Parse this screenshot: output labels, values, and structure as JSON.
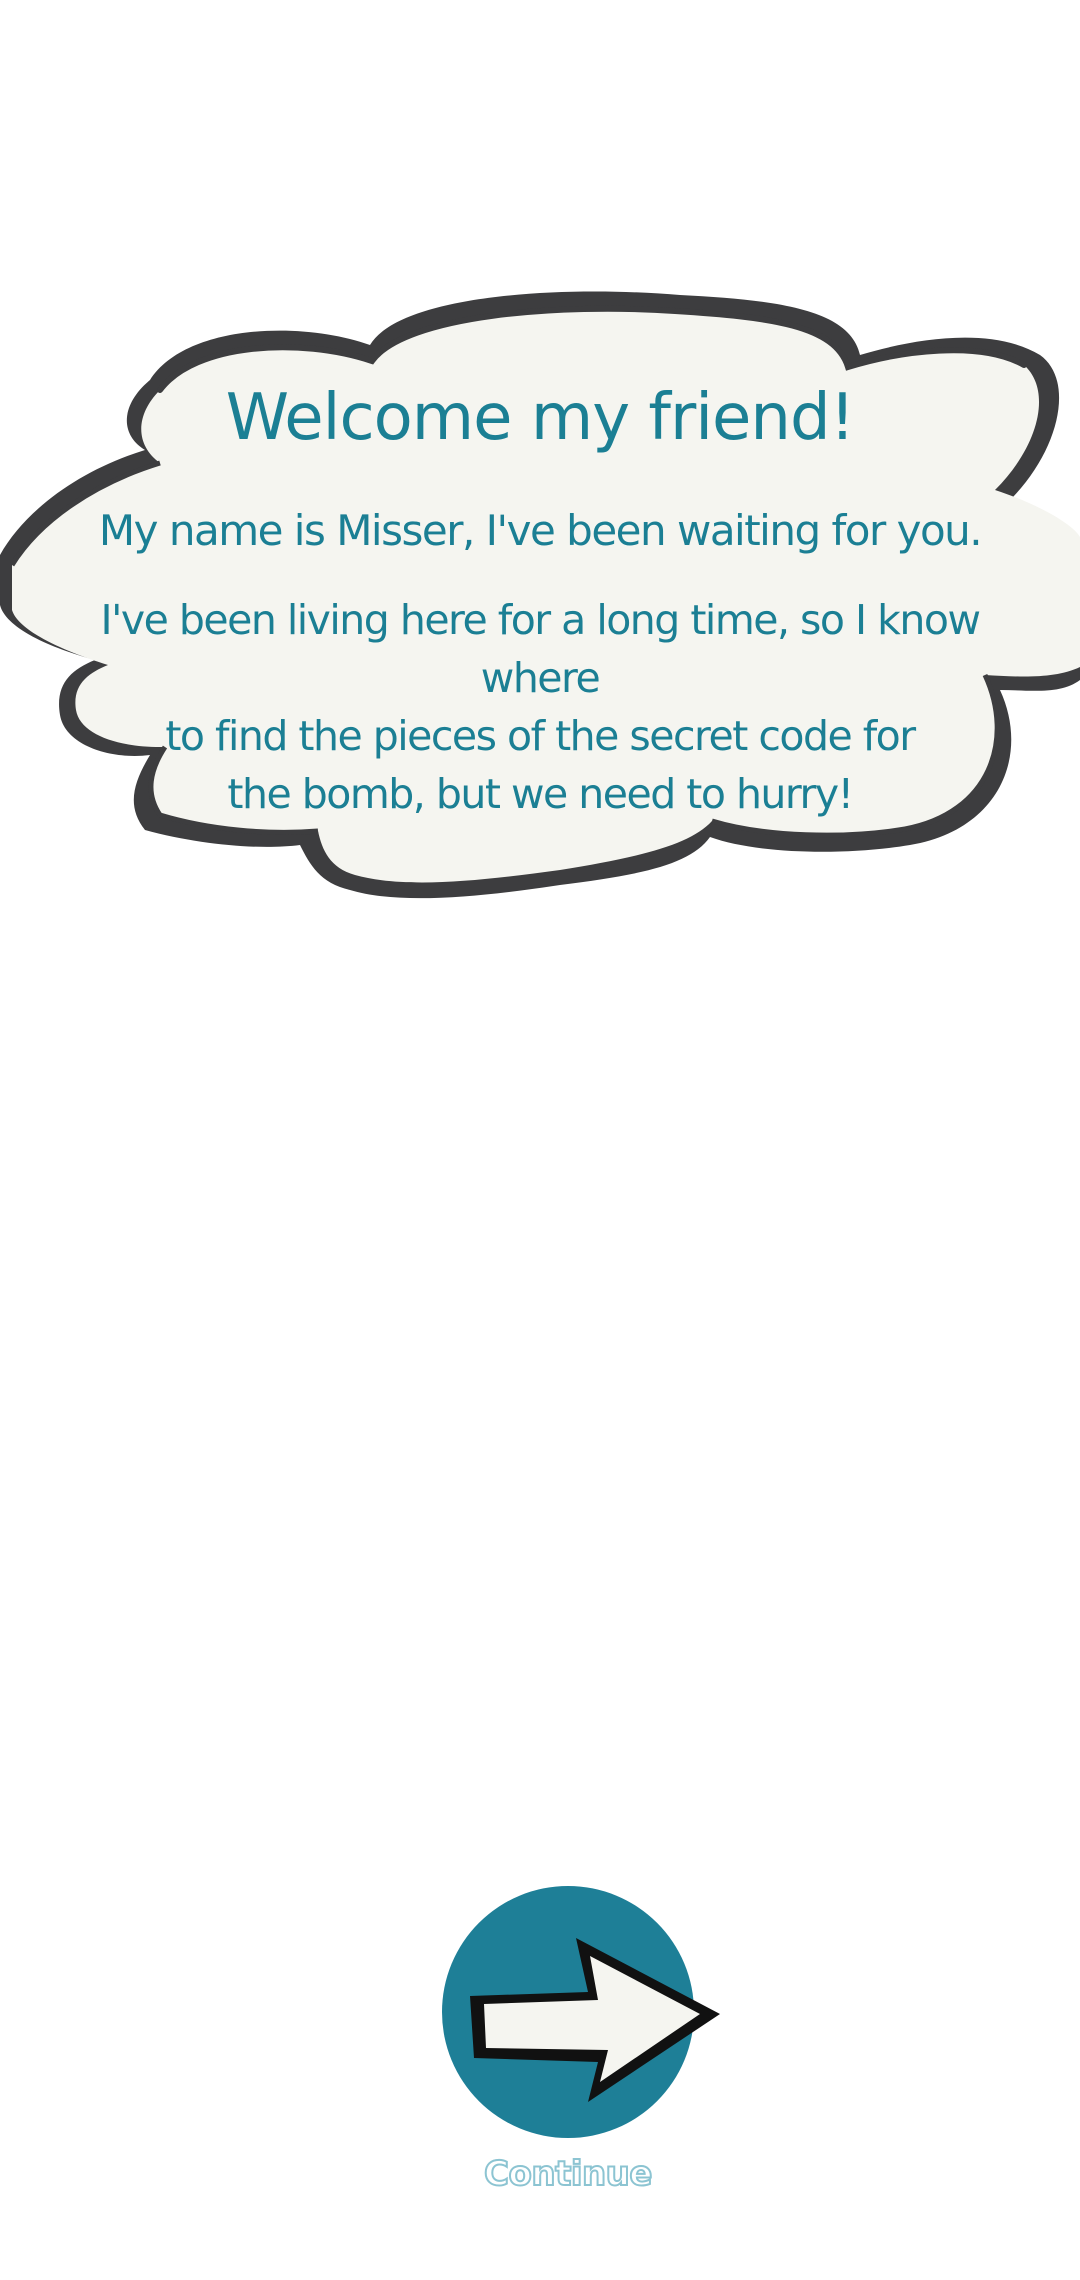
{
  "dialog": {
    "title": "Welcome my friend!",
    "line1": "My name is Misser, I've been waiting for you.",
    "line2": "I've been living here for a long time, so I know where to find the pieces of the secret code for the bomb, but we need to hurry!",
    "line2_parts": [
      "I've been living here for a long time, so I know where",
      "to find the pieces of the secret code for",
      "the bomb, but we need to hurry!"
    ]
  },
  "continue": {
    "label": "Continue",
    "icon": "arrow-right-icon"
  },
  "colors": {
    "text": "#1b7f94",
    "bubble_fill": "#f5f5f0",
    "bubble_outline": "#3d3d3f",
    "button_fill": "#1e7f97",
    "arrow_fill": "#f5f5f0",
    "label_outline": "#8cc4d2"
  }
}
